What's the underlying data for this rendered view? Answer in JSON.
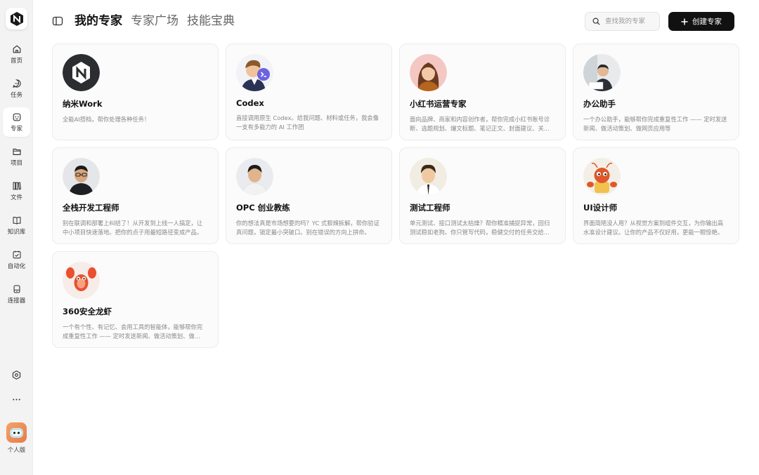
{
  "sidebar": {
    "items": [
      {
        "label": "首页",
        "icon": "home-icon"
      },
      {
        "label": "任务",
        "icon": "chat-icon"
      },
      {
        "label": "专家",
        "icon": "expert-icon",
        "active": true
      },
      {
        "label": "项目",
        "icon": "folder-icon"
      },
      {
        "label": "文件",
        "icon": "library-icon"
      },
      {
        "label": "知识库",
        "icon": "book-icon"
      },
      {
        "label": "自动化",
        "icon": "calendar-check-icon"
      },
      {
        "label": "连接器",
        "icon": "device-icon"
      }
    ],
    "user_label": "个人版"
  },
  "header": {
    "tabs": [
      {
        "label": "我的专家",
        "active": true
      },
      {
        "label": "专家广场",
        "active": false
      },
      {
        "label": "技能宝典",
        "active": false
      }
    ],
    "search_placeholder": "查找我的专家",
    "create_label": "创建专家"
  },
  "experts": [
    {
      "name": "纳米Work",
      "desc": "全能AI搭档，帮你处理各种任务！",
      "avatar": "nami-logo"
    },
    {
      "name": "Codex",
      "desc": "直接调用原生 Codex。给我问题、材料或任务，我会像一支有多能力的 AI 工作团",
      "avatar": "codex-avatar"
    },
    {
      "name": "小红书运营专家",
      "desc": "面向品牌、商家和内容创作者，帮你完成小红书账号诊断、选题规划、爆文标题、笔记正文、封面建议、关...",
      "avatar": "woman-avatar"
    },
    {
      "name": "办公助手",
      "desc": "一个办公助手，能够帮你完成重复性工作 —— 定时发送新闻、做活动策划、做网页应用等",
      "avatar": "office-avatar"
    },
    {
      "name": "全栈开发工程师",
      "desc": "别在联调和部署上纠结了！从开发到上线一人搞定，让中小项目快速落地。把你的点子用最短路径变成产品。",
      "avatar": "dev-avatar"
    },
    {
      "name": "OPC 创业教练",
      "desc": "你的想法真是市场想要的吗？YC 式狠辣拆解，帮你验证真问题，锁定最小突破口。别在错误的方向上拼命。",
      "avatar": "coach-avatar"
    },
    {
      "name": "测试工程师",
      "desc": "单元测试、接口测试太枯燥？帮你精准捕捉异常，回归测试稳如老狗。你只管写代码，稳健交付的任务交给...",
      "avatar": "tester-avatar"
    },
    {
      "name": "UI设计师",
      "desc": "界面简陋没人用？从视觉方案到组件交互，为你输出高水准设计建议。让你的产品不仅好用，更能一眼惊艳。",
      "avatar": "designer-avatar"
    },
    {
      "name": "360安全龙虾",
      "desc": "一个有个性、有记忆、会用工具的智能体，能够帮你完成重复性工作 —— 定时发送新闻、做活动策划、做...",
      "avatar": "lobster-avatar"
    }
  ]
}
